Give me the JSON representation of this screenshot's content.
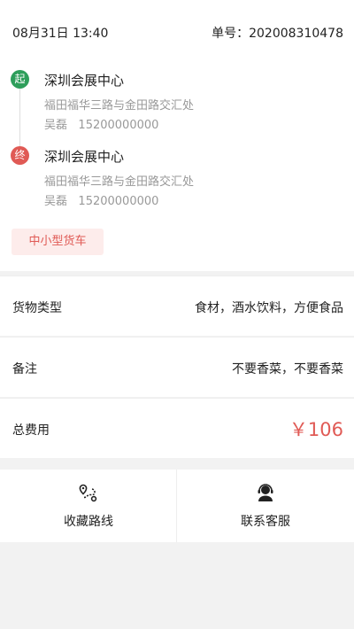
{
  "header": {
    "datetime": "08月31日 13:40",
    "order_no": "单号：202008310478"
  },
  "route": {
    "start": {
      "badge": "起",
      "name": "深圳会展中心",
      "address": "福田福华三路与金田路交汇处",
      "contact_name": "吴磊",
      "contact_phone": "15200000000"
    },
    "end": {
      "badge": "终",
      "name": "深圳会展中心",
      "address": "福田福华三路与金田路交汇处",
      "contact_name": "吴磊",
      "contact_phone": "15200000000"
    }
  },
  "vehicle_type": "中小型货车",
  "details": {
    "cargo_label": "货物类型",
    "cargo_value": "食材，酒水饮料，方便食品",
    "remark_label": "备注",
    "remark_value": "不要香菜，不要香菜",
    "total_label": "总费用",
    "total_value": "￥106"
  },
  "actions": {
    "favorite_route": "收藏路线",
    "contact_service": "联系客服"
  },
  "colors": {
    "start_badge": "#2e9e5b",
    "end_badge": "#e05a55",
    "accent_red": "#e05a55"
  }
}
